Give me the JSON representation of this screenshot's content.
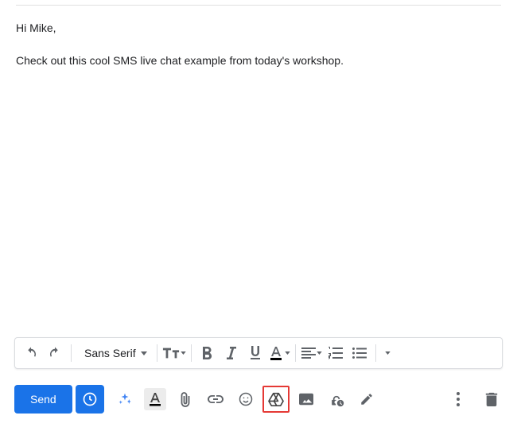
{
  "email_body": {
    "greeting": "Hi Mike,",
    "line1": "Check out this cool SMS live chat example from today's workshop."
  },
  "format_toolbar": {
    "font_family": "Sans Serif"
  },
  "actions": {
    "send_label": "Send"
  }
}
